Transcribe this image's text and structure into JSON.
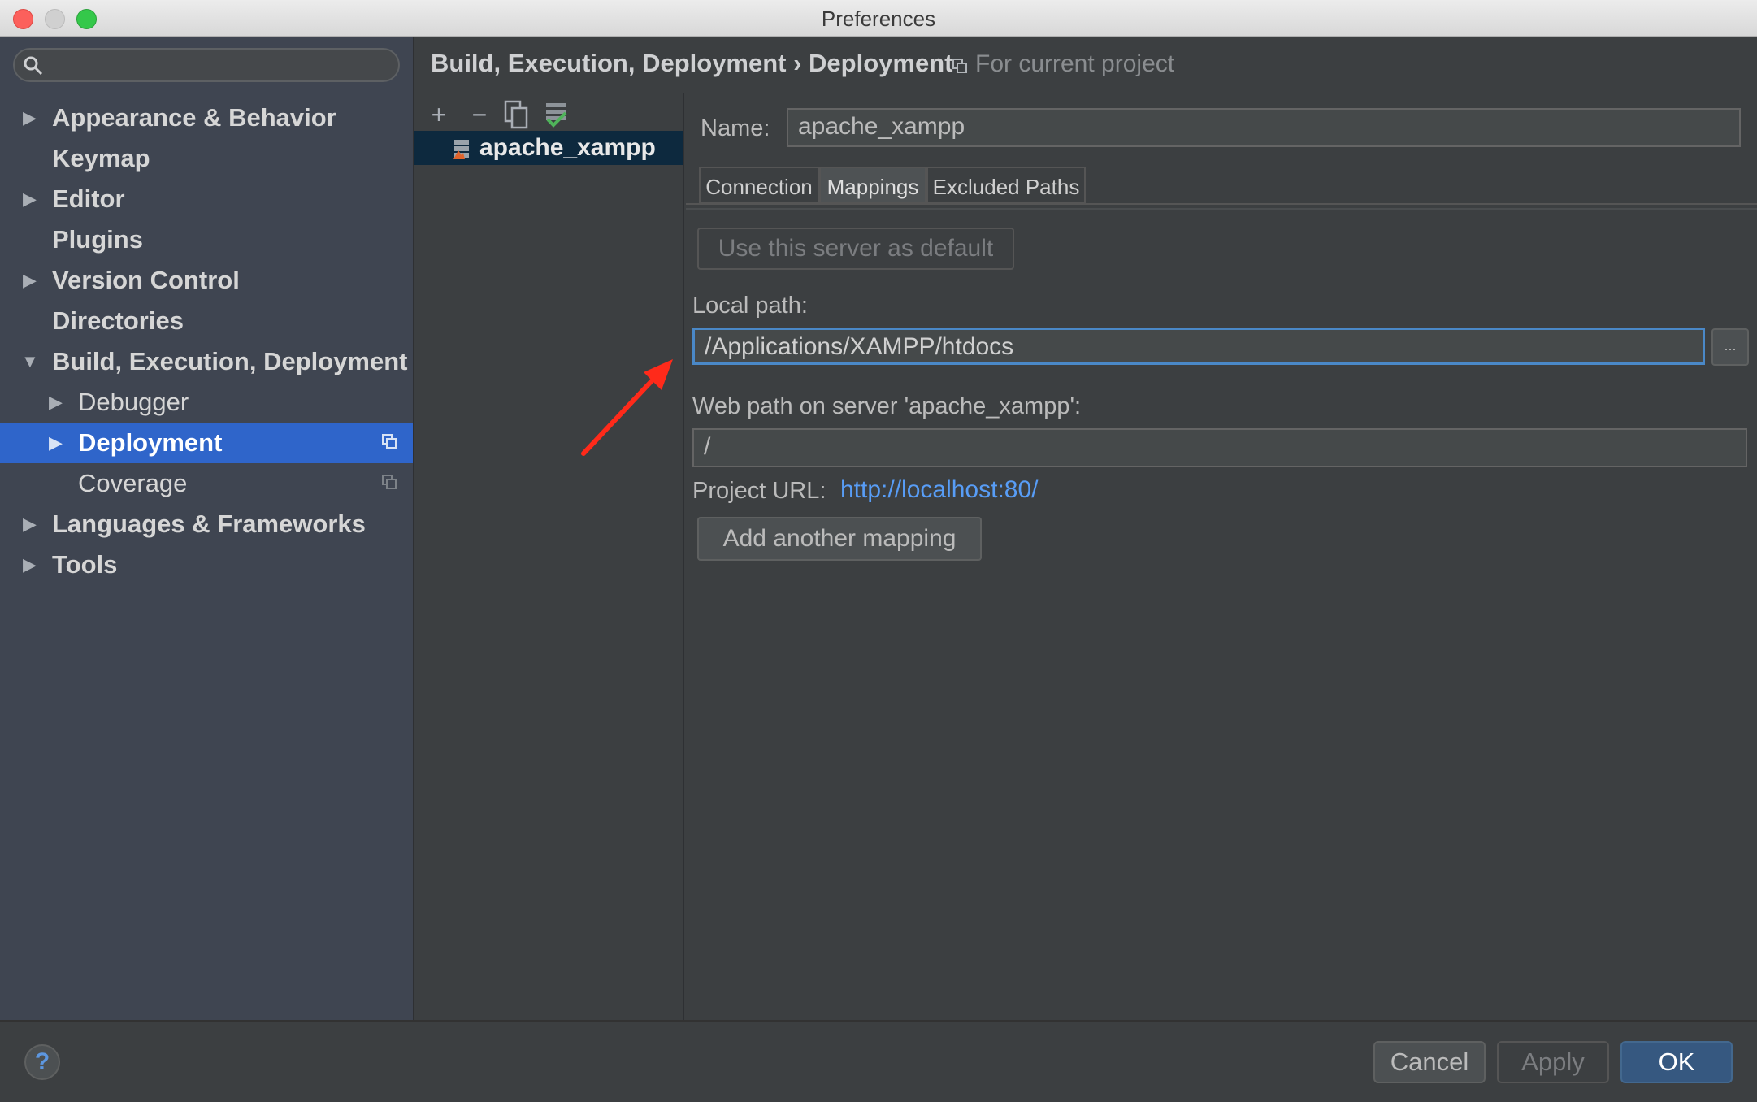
{
  "window": {
    "title": "Preferences"
  },
  "sidebar": {
    "items": [
      {
        "label": "Appearance & Behavior",
        "arrow": "▶"
      },
      {
        "label": "Keymap",
        "arrow": ""
      },
      {
        "label": "Editor",
        "arrow": "▶"
      },
      {
        "label": "Plugins",
        "arrow": ""
      },
      {
        "label": "Version Control",
        "arrow": "▶"
      },
      {
        "label": "Directories",
        "arrow": ""
      },
      {
        "label": "Build, Execution, Deployment",
        "arrow": "▼"
      },
      {
        "label": "Debugger",
        "arrow": "▶"
      },
      {
        "label": "Deployment",
        "arrow": "▶"
      },
      {
        "label": "Coverage",
        "arrow": ""
      },
      {
        "label": "Languages & Frameworks",
        "arrow": "▶"
      },
      {
        "label": "Tools",
        "arrow": "▶"
      }
    ]
  },
  "breadcrumb": {
    "path": "Build, Execution, Deployment › Deployment",
    "hint": "For current project"
  },
  "servers": {
    "toolbar": {
      "add": "+",
      "remove": "−"
    },
    "list": [
      {
        "name": "apache_xampp"
      }
    ]
  },
  "form": {
    "name_label": "Name:",
    "name_value": "apache_xampp",
    "tabs": [
      "Connection",
      "Mappings",
      "Excluded Paths"
    ],
    "default_button": "Use this server as default",
    "local_path_label": "Local path:",
    "local_path_value": "/Applications/XAMPP/htdocs",
    "browse_label": "...",
    "web_path_label": "Web path on server 'apache_xampp':",
    "web_path_value": "/",
    "project_url_label": "Project URL:",
    "project_url_value": "http://localhost:80/",
    "add_mapping_button": "Add another mapping"
  },
  "footer": {
    "help": "?",
    "cancel": "Cancel",
    "apply": "Apply",
    "ok": "OK"
  },
  "colors": {
    "accent": "#2f65ca",
    "link": "#589df6",
    "arrow_annotation": "#ff2a1a"
  }
}
